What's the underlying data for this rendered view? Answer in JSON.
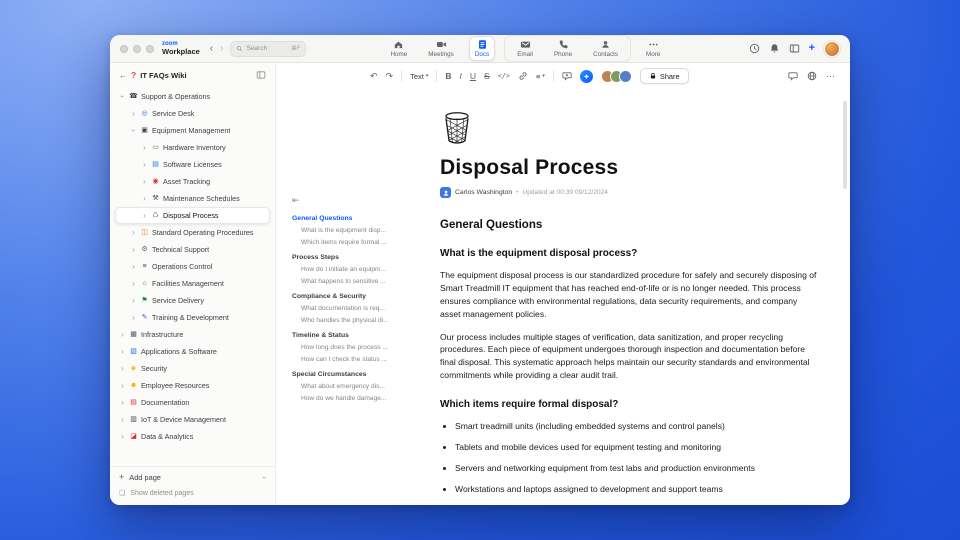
{
  "colors": {
    "accent": "#0b5cff"
  },
  "titlebar": {
    "logo_top": "zoom",
    "logo_bottom": "Workplace",
    "search": {
      "placeholder": "Search",
      "shortcut": "⌘F"
    },
    "tabs": [
      {
        "label": "Home",
        "icon": "home-icon",
        "active": false,
        "group": false
      },
      {
        "label": "Meetings",
        "icon": "meetings-icon",
        "active": false,
        "group": false
      },
      {
        "label": "Docs",
        "icon": "docs-icon",
        "active": true,
        "group": false
      },
      {
        "label": "Email",
        "icon": "email-icon",
        "active": false,
        "group": true
      },
      {
        "label": "Phone",
        "icon": "phone-icon",
        "active": false,
        "group": true
      },
      {
        "label": "Contacts",
        "icon": "contacts-icon",
        "active": false,
        "group": true
      },
      {
        "label": "More",
        "icon": "more-icon",
        "active": false,
        "group": false
      }
    ]
  },
  "sidebar": {
    "title": "IT FAQs Wiki",
    "tree": [
      {
        "label": "Support & Operations",
        "level": 0,
        "glyph": "☎",
        "icon": "phone-icon",
        "color": "#37474f",
        "expanded": true,
        "selected": false
      },
      {
        "label": "Service Desk",
        "level": 1,
        "glyph": "◎",
        "icon": "headset-icon",
        "color": "#1a73e8",
        "expanded": false,
        "selected": false
      },
      {
        "label": "Equipment Management",
        "level": 1,
        "glyph": "▣",
        "icon": "equipment-icon",
        "color": "#37474f",
        "expanded": true,
        "selected": false
      },
      {
        "label": "Hardware Inventory",
        "level": 2,
        "glyph": "▭",
        "icon": "hardware-icon",
        "color": "#5f6368",
        "expanded": false,
        "selected": false
      },
      {
        "label": "Software Licenses",
        "level": 2,
        "glyph": "▤",
        "icon": "license-icon",
        "color": "#1a73e8",
        "expanded": false,
        "selected": false
      },
      {
        "label": "Asset Tracking",
        "level": 2,
        "glyph": "◉",
        "icon": "pin-icon",
        "color": "#d93025",
        "expanded": false,
        "selected": false
      },
      {
        "label": "Maintenance Schedules",
        "level": 2,
        "glyph": "⚒",
        "icon": "tools-icon",
        "color": "#37474f",
        "expanded": false,
        "selected": false
      },
      {
        "label": "Disposal Process",
        "level": 2,
        "glyph": "♺",
        "icon": "trash-icon",
        "color": "#5f6368",
        "expanded": false,
        "selected": true
      },
      {
        "label": "Standard Operating Procedures",
        "level": 1,
        "glyph": "◫",
        "icon": "book-icon",
        "color": "#e8710a",
        "expanded": false,
        "selected": false
      },
      {
        "label": "Technical Support",
        "level": 1,
        "glyph": "⚙",
        "icon": "wrench-icon",
        "color": "#5f6368",
        "expanded": false,
        "selected": false
      },
      {
        "label": "Operations Control",
        "level": 1,
        "glyph": "≡",
        "icon": "controls-icon",
        "color": "#37474f",
        "expanded": false,
        "selected": false
      },
      {
        "label": "Facilities Management",
        "level": 1,
        "glyph": "⌂",
        "icon": "building-icon",
        "color": "#795548",
        "expanded": false,
        "selected": false
      },
      {
        "label": "Service Delivery",
        "level": 1,
        "glyph": "⚑",
        "icon": "delivery-icon",
        "color": "#188038",
        "expanded": false,
        "selected": false
      },
      {
        "label": "Training & Development",
        "level": 1,
        "glyph": "✎",
        "icon": "training-icon",
        "color": "#8430ce",
        "expanded": false,
        "selected": false
      },
      {
        "label": "Infrastructure",
        "level": 0,
        "glyph": "▦",
        "icon": "server-icon",
        "color": "#455a64",
        "expanded": false,
        "selected": false
      },
      {
        "label": "Applications & Software",
        "level": 0,
        "glyph": "▧",
        "icon": "apps-icon",
        "color": "#1a73e8",
        "expanded": false,
        "selected": false
      },
      {
        "label": "Security",
        "level": 0,
        "glyph": "◈",
        "icon": "shield-icon",
        "color": "#f9ab00",
        "expanded": false,
        "selected": false
      },
      {
        "label": "Employee Resources",
        "level": 0,
        "glyph": "☻",
        "icon": "people-icon",
        "color": "#f9ab00",
        "expanded": false,
        "selected": false
      },
      {
        "label": "Documentation",
        "level": 0,
        "glyph": "▤",
        "icon": "books-icon",
        "color": "#d93025",
        "expanded": false,
        "selected": false
      },
      {
        "label": "IoT & Device Management",
        "level": 0,
        "glyph": "▥",
        "icon": "device-icon",
        "color": "#37474f",
        "expanded": false,
        "selected": false
      },
      {
        "label": "Data & Analytics",
        "level": 0,
        "glyph": "◪",
        "icon": "chart-icon",
        "color": "#d93025",
        "expanded": false,
        "selected": false
      }
    ],
    "add_page": "Add page",
    "show_deleted": "Show deleted pages"
  },
  "outline": {
    "items": [
      {
        "label": "General Questions",
        "type": "section",
        "active": true
      },
      {
        "label": "What is the equipment disp...",
        "type": "child",
        "active": false
      },
      {
        "label": "Which items require formal ...",
        "type": "child",
        "active": false
      },
      {
        "label": "Process Steps",
        "type": "section",
        "active": false
      },
      {
        "label": "How do I initiate an equipm...",
        "type": "child",
        "active": false
      },
      {
        "label": "What happens to sensitive ...",
        "type": "child",
        "active": false
      },
      {
        "label": "Compliance & Security",
        "type": "section",
        "active": false
      },
      {
        "label": "What documentation is req...",
        "type": "child",
        "active": false
      },
      {
        "label": "Who handles the physical di...",
        "type": "child",
        "active": false
      },
      {
        "label": "Timeline & Status",
        "type": "section",
        "active": false
      },
      {
        "label": "How long does the process ...",
        "type": "child",
        "active": false
      },
      {
        "label": "How can I check the status ...",
        "type": "child",
        "active": false
      },
      {
        "label": "Special Circumstances",
        "type": "section",
        "active": false
      },
      {
        "label": "What about emergency dis...",
        "type": "child",
        "active": false
      },
      {
        "label": "How do we handle damage...",
        "type": "child",
        "active": false
      }
    ]
  },
  "toolbar": {
    "text_style": "Text",
    "bold": "B",
    "italic": "I",
    "underline": "U",
    "strike": "S",
    "code": "</>",
    "align": "≡",
    "share": "Share"
  },
  "document": {
    "title": "Disposal Process",
    "author": "Carlos Washington",
    "separator": "•",
    "updated": "Updated at 00:39 09/12/2024",
    "section_heading": "General Questions",
    "q1": {
      "heading": "What is the equipment disposal process?",
      "paragraphs": [
        "The equipment disposal process is our standardized procedure for safely and securely disposing of Smart Treadmill IT equipment that has reached end-of-life or is no longer needed. This process ensures compliance with environmental regulations, data security requirements, and company asset management policies.",
        "Our process includes multiple stages of verification, data sanitization, and proper recycling procedures. Each piece of equipment undergoes thorough inspection and documentation before final disposal. This systematic approach helps maintain our security standards and environmental commitments while providing a clear audit trail."
      ]
    },
    "q2": {
      "heading": "Which items require formal disposal?",
      "bullets": [
        "Smart treadmill units (including embedded systems and control panels)",
        "Tablets and mobile devices used for equipment testing and monitoring",
        "Servers and networking equipment from test labs and production environments",
        "Workstations and laptops assigned to development and support teams"
      ]
    }
  }
}
